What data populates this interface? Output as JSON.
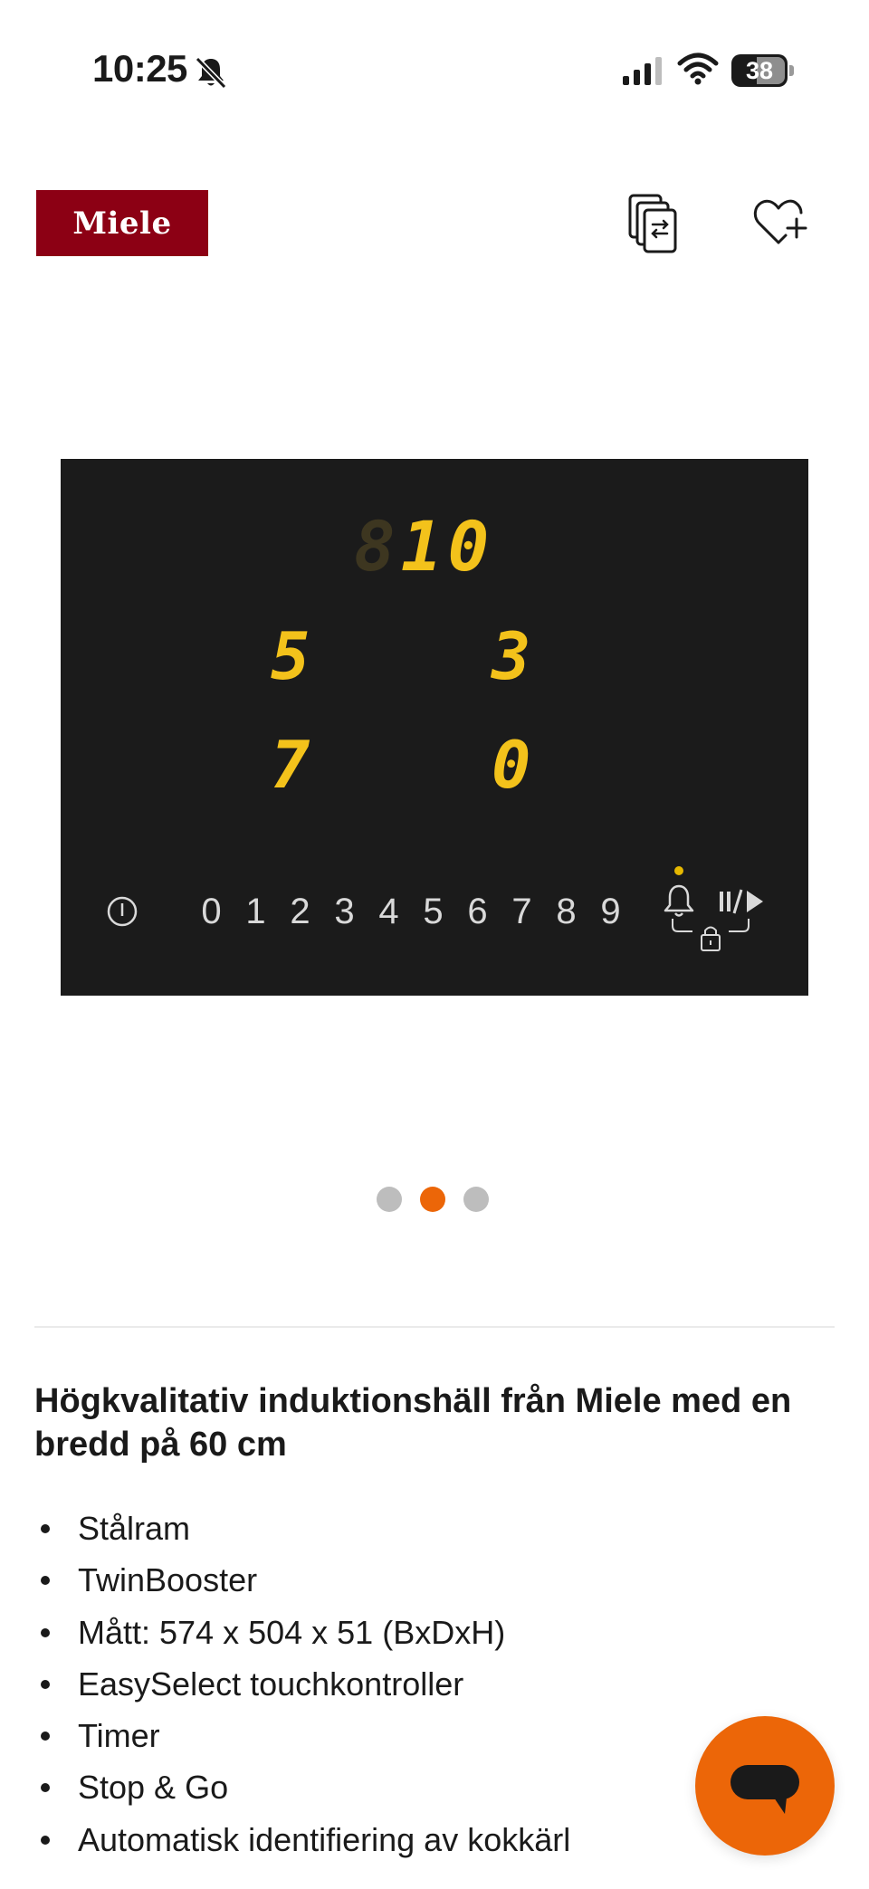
{
  "status_bar": {
    "time": "10:25",
    "battery_level": "38"
  },
  "header": {
    "logo_text": "Miele",
    "brand_color": "#8c0014",
    "accent_color": "#ec6608"
  },
  "product_image": {
    "displays": {
      "top": "10",
      "middle_left": "5",
      "middle_right": "3",
      "bottom_left": "7",
      "bottom_right": "0"
    },
    "power_levels": [
      "0",
      "1",
      "2",
      "3",
      "4",
      "5",
      "6",
      "7",
      "8",
      "9"
    ]
  },
  "carousel": {
    "total": 3,
    "active_index": 1
  },
  "description": {
    "title": "Högkvalitativ induktionshäll från Miele med en bredd på 60 cm",
    "features": [
      "Stålram",
      "TwinBooster",
      "Mått: 574 x 504 x 51 (BxDxH)",
      "EasySelect touchkontroller",
      "Timer",
      "Stop & Go",
      "Automatisk identifiering av kokkärl"
    ]
  },
  "icons": {
    "status": [
      "mute-icon",
      "signal-icon",
      "wifi-icon",
      "battery-icon"
    ],
    "header": [
      "compare-icon",
      "wishlist-add-icon"
    ],
    "cooktop": [
      "power-icon",
      "timer-bell-icon",
      "stop-go-icon",
      "lock-icon"
    ],
    "chat": "chat-icon"
  }
}
